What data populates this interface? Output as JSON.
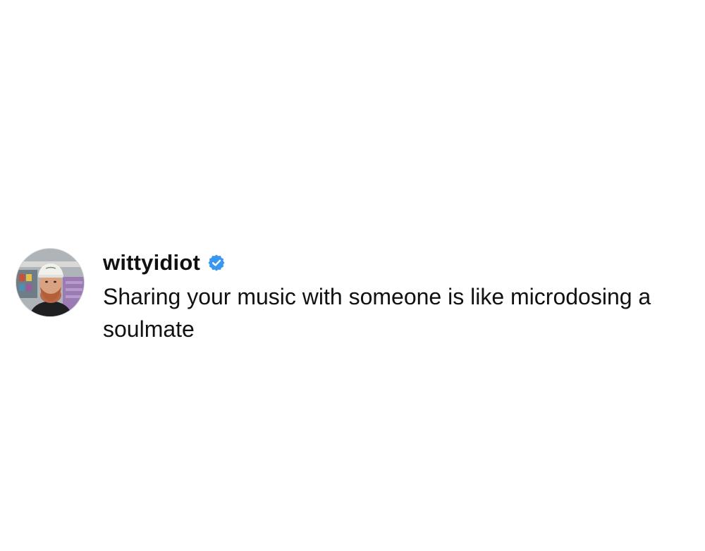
{
  "post": {
    "username": "wittyidiot",
    "text": "Sharing your music with someone is like microdosing a soulmate",
    "avatar_icon": "avatar-icon",
    "verified_icon": "verified-badge-icon",
    "verified_color": "#3897f0"
  }
}
